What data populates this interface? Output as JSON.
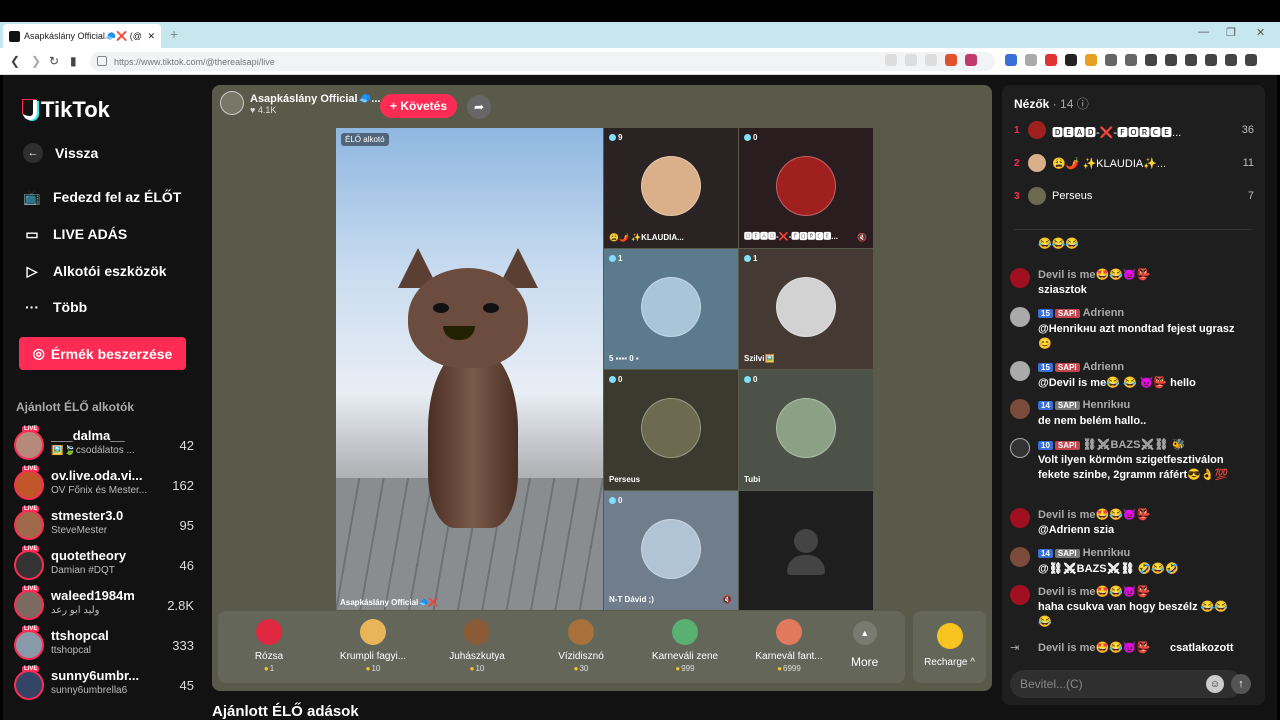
{
  "browser": {
    "tab_title": "Asapkáslány Official🧢❌ (@",
    "url": "https://www.tiktok.com/@therealsapi/live"
  },
  "sidebar": {
    "logo": "TikTok",
    "back": "Vissza",
    "items": [
      {
        "label": "Fedezd fel az ÉLŐT",
        "icon": "tv-icon"
      },
      {
        "label": "LIVE ADÁS",
        "icon": "camera-icon"
      },
      {
        "label": "Alkotói eszközök",
        "icon": "play-square-icon"
      },
      {
        "label": "Több",
        "icon": "more-dots-icon"
      }
    ],
    "coins_button": "Érmék beszerzése",
    "recommended_title": "Ajánlott ÉLŐ alkotók",
    "creators": [
      {
        "name": "___dalma__",
        "sub": "🖼️🍃csodálatos ...",
        "count": "42",
        "color": "#b68a7a"
      },
      {
        "name": "ov.live.oda.vi...",
        "sub": "OV Főnix és Mester...",
        "count": "162",
        "color": "#c0562a"
      },
      {
        "name": "stmester3.0",
        "sub": "SteveMester",
        "count": "95",
        "color": "#a06a4a"
      },
      {
        "name": "quotetheory",
        "sub": "Damian #DQT",
        "count": "46",
        "color": "#333333"
      },
      {
        "name": "waleed1984m",
        "sub": "وليد ابو رعد",
        "count": "2.8K",
        "color": "#7a6a60"
      },
      {
        "name": "ttshopcal",
        "sub": "ttshopcal",
        "count": "333",
        "color": "#8899aa"
      },
      {
        "name": "sunny6umbr...",
        "sub": "sunny6umbrella6",
        "count": "45",
        "color": "#334466"
      }
    ],
    "live_badge": "LIVE"
  },
  "stream": {
    "host_name": "Asapkáslány Official🧢...",
    "likes": "♥ 4.1K",
    "follow_button": "+ Követés",
    "creator_badge": "ÉLŐ alkotó",
    "main_name": "Asapkáslány Official🧢❌",
    "guests": [
      {
        "count": "9",
        "name": "😩🌶️ ✨KLAUDIA...",
        "bg": "#2b2323",
        "av": "#d9b08a"
      },
      {
        "count": "0",
        "name": "🅳🅴🅰🅳-❌-🅵🅾🆁🅲🅴...",
        "bg": "#2a1d20",
        "av": "#a02020"
      },
      {
        "count": "1",
        "name": "5 ▪▪▪▪ 0 ▪",
        "bg": "#5b7a8c",
        "av": "#a9c6d8"
      },
      {
        "count": "1",
        "name": "Szilvi🖼️",
        "bg": "#453a33",
        "av": "#d2d2d2"
      },
      {
        "count": "0",
        "name": "Perseus",
        "bg": "#3a3a2e",
        "av": "#6c6a50"
      },
      {
        "count": "0",
        "name": "Tubi",
        "bg": "#4c5247",
        "av": "#8ca086"
      },
      {
        "count": "0",
        "name": "N-T Dávid ;)",
        "bg": "#6f7d8d",
        "av": "#b0c4d6"
      }
    ],
    "gifts": [
      {
        "name": "Rózsa",
        "price": "1",
        "color": "#e02840"
      },
      {
        "name": "Krumpli fagyi...",
        "price": "10",
        "color": "#e8b55a"
      },
      {
        "name": "Juhászkutya",
        "price": "10",
        "color": "#8b5a36"
      },
      {
        "name": "Vízidisznó",
        "price": "30",
        "color": "#a8703a"
      },
      {
        "name": "Karneváli zene",
        "price": "999",
        "color": "#5ab070"
      },
      {
        "name": "Karnevál fant...",
        "price": "6999",
        "color": "#e07a5a"
      }
    ],
    "more_label": "More",
    "recharge_label": "Recharge ^",
    "recommended_streams": "Ajánlott ÉLŐ adások"
  },
  "chat": {
    "viewers_label": "Nézők",
    "viewers_count": "· 14",
    "ranking": [
      {
        "rank": "1",
        "name": "🅳🅴🅰🅳-❌-🅵🅾🆁🅲🅴...",
        "score": "36"
      },
      {
        "rank": "2",
        "name": "😩🌶️ ✨KLAUDIA✨...",
        "score": "11"
      },
      {
        "rank": "3",
        "name": "Perseus",
        "score": "7"
      }
    ],
    "messages": [
      {
        "user": "",
        "level": "",
        "tag": "",
        "text": "😂😂😂",
        "color": "#555"
      },
      {
        "user": "Devil is me🤩😂👿👺",
        "level": "",
        "tag": "",
        "text": "sziasztok",
        "color": "#a01020"
      },
      {
        "user": "Adrienn",
        "level": "15",
        "tag": "SAPI",
        "text": "@Henrikнu azt mondtad fejest ugrasz😊",
        "color": "#aaa"
      },
      {
        "user": "Adrienn",
        "level": "15",
        "tag": "SAPI",
        "text": "@Devil is me😂 😂 👿👺 hello",
        "color": "#aaa"
      },
      {
        "user": "Henrikнu",
        "level": "14",
        "tag": "SAPI",
        "text": "de nem belém hallo..",
        "color": "#7a4a3a"
      },
      {
        "user": "⛓⚔BAZS⚔⛓ 🐝",
        "level": "10",
        "tag": "SAPI",
        "text": "Volt ilyen körmöm szigetfesztiválon fekete szinbe, 2gramm ráfért😎👌💯",
        "color": "#333"
      },
      {
        "user": "Devil is me🤩😂👿👺",
        "level": "",
        "tag": "",
        "text": "@Adrienn szia",
        "color": "#a01020"
      },
      {
        "user": "Henrikнu",
        "level": "14",
        "tag": "SAPI",
        "text": "@⛓⚔BAZS⚔⛓ 🤣😂🤣",
        "color": "#7a4a3a"
      },
      {
        "user": "Devil is me🤩😂👿👺",
        "level": "",
        "tag": "",
        "text": "haha csukva van hogy beszélz 😂😂😂",
        "color": "#a01020"
      },
      {
        "user": "Devil is me🤩😂👿👺",
        "level": "",
        "tag": "",
        "text": "csatlakozott",
        "color": "#555"
      }
    ],
    "input_placeholder": "Bevitel...(C)"
  }
}
